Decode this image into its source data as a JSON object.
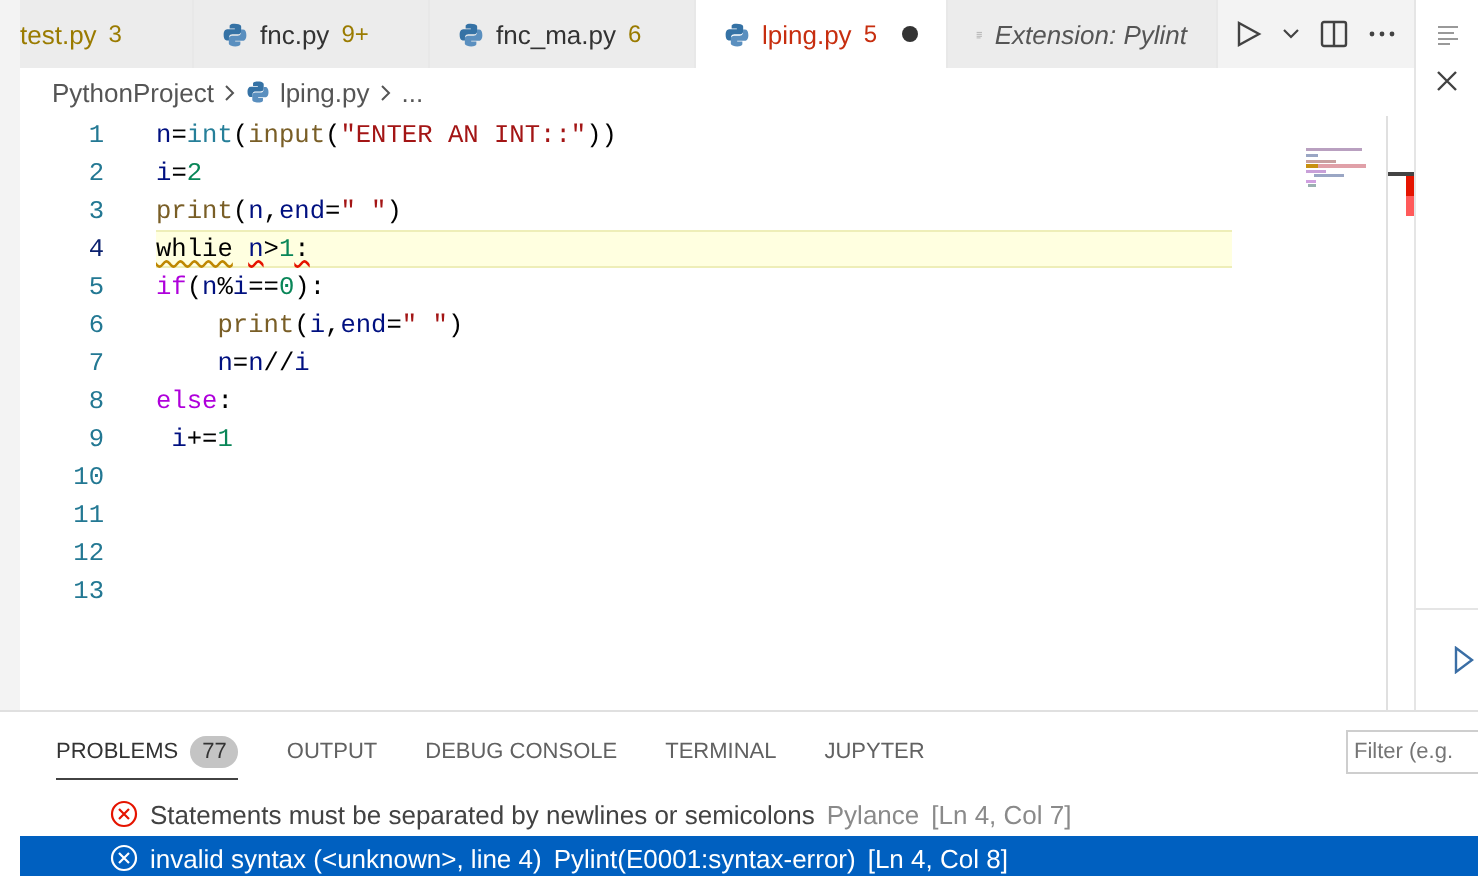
{
  "tabs": [
    {
      "label": "test.py",
      "badge": "3",
      "color": "#9a7b00",
      "highlighted": true,
      "kind": "plain",
      "dirty": false,
      "selected": false
    },
    {
      "label": "fnc.py",
      "badge": "9+",
      "color": "#9a7b00",
      "highlighted": false,
      "kind": "python",
      "dirty": false,
      "selected": false
    },
    {
      "label": "fnc_ma.py",
      "badge": "6",
      "color": "#9a7b00",
      "highlighted": false,
      "kind": "python",
      "dirty": false,
      "selected": false
    },
    {
      "label": "lping.py",
      "badge": "5",
      "color": "#c72e0f",
      "highlighted": true,
      "kind": "python",
      "dirty": true,
      "selected": true
    },
    {
      "label": "Extension: Pylint",
      "kind": "extension",
      "selected": false
    }
  ],
  "breadcrumb": {
    "folder": "PythonProject",
    "file": "lping.py",
    "more": "..."
  },
  "code": [
    {
      "number": "1",
      "current": false,
      "tokens": [
        {
          "t": "n",
          "kind": "var"
        },
        {
          "t": "=",
          "kind": "plain"
        },
        {
          "t": "int",
          "kind": "class"
        },
        {
          "t": "(",
          "kind": "plain"
        },
        {
          "t": "input",
          "kind": "func"
        },
        {
          "t": "(",
          "kind": "plain"
        },
        {
          "t": "\"ENTER AN INT::\"",
          "kind": "string"
        },
        {
          "t": "))",
          "kind": "plain"
        }
      ]
    },
    {
      "number": "2",
      "current": false,
      "tokens": [
        {
          "t": "i",
          "kind": "var"
        },
        {
          "t": "=",
          "kind": "plain"
        },
        {
          "t": "2",
          "kind": "number"
        }
      ]
    },
    {
      "number": "3",
      "current": false,
      "tokens": [
        {
          "t": "print",
          "kind": "func"
        },
        {
          "t": "(",
          "kind": "plain"
        },
        {
          "t": "n",
          "kind": "var"
        },
        {
          "t": ",",
          "kind": "plain"
        },
        {
          "t": "end",
          "kind": "var"
        },
        {
          "t": "=",
          "kind": "plain"
        },
        {
          "t": "\" \"",
          "kind": "string"
        },
        {
          "t": ")",
          "kind": "plain"
        }
      ]
    },
    {
      "number": "4",
      "current": true,
      "tokens": [
        {
          "t": "whlie",
          "kind": "plain",
          "warning": true,
          "error": false
        },
        {
          "t": " n",
          "kind": "var",
          "warning": false,
          "error": true
        },
        {
          "t": ">",
          "kind": "plain",
          "warning": false,
          "error": false
        },
        {
          "t": "1",
          "kind": "number",
          "warning": false,
          "error": false
        },
        {
          "t": ":",
          "kind": "plain",
          "warning": false,
          "error": true
        }
      ]
    },
    {
      "number": "5",
      "current": false,
      "tokens": [
        {
          "t": "if",
          "kind": "keyword"
        },
        {
          "t": "(",
          "kind": "plain"
        },
        {
          "t": "n",
          "kind": "var"
        },
        {
          "t": "%",
          "kind": "plain"
        },
        {
          "t": "i",
          "kind": "var"
        },
        {
          "t": "==",
          "kind": "plain"
        },
        {
          "t": "0",
          "kind": "number"
        },
        {
          "t": "):",
          "kind": "plain"
        }
      ]
    },
    {
      "number": "6",
      "current": false,
      "tokens": [
        {
          "t": "    print",
          "kind": "func"
        },
        {
          "t": "(",
          "kind": "plain"
        },
        {
          "t": "i",
          "kind": "var"
        },
        {
          "t": ",",
          "kind": "plain"
        },
        {
          "t": "end",
          "kind": "var"
        },
        {
          "t": "=",
          "kind": "plain"
        },
        {
          "t": "\" \"",
          "kind": "string"
        },
        {
          "t": ")",
          "kind": "plain"
        }
      ]
    },
    {
      "number": "7",
      "current": false,
      "tokens": [
        {
          "t": "    n",
          "kind": "var"
        },
        {
          "t": "=",
          "kind": "plain"
        },
        {
          "t": "n",
          "kind": "var"
        },
        {
          "t": "//",
          "kind": "plain"
        },
        {
          "t": "i",
          "kind": "var"
        }
      ]
    },
    {
      "number": "8",
      "current": false,
      "tokens": [
        {
          "t": "else",
          "kind": "keyword"
        },
        {
          "t": ":",
          "kind": "plain"
        }
      ]
    },
    {
      "number": "9",
      "current": false,
      "tokens": [
        {
          "t": " i",
          "kind": "var"
        },
        {
          "t": "+=",
          "kind": "plain"
        },
        {
          "t": "1",
          "kind": "number"
        }
      ]
    },
    {
      "number": "10",
      "current": false
    },
    {
      "number": "11",
      "current": false
    },
    {
      "number": "12",
      "current": false
    },
    {
      "number": "13",
      "current": false
    }
  ],
  "panel_tabs": [
    {
      "label": "PROBLEMS",
      "badge": "77",
      "selected": true
    },
    {
      "label": "OUTPUT",
      "selected": false
    },
    {
      "label": "DEBUG CONSOLE",
      "selected": false
    },
    {
      "label": "TERMINAL",
      "selected": false
    },
    {
      "label": "JUPYTER",
      "selected": false
    }
  ],
  "filter": {
    "placeholder": "Filter (e.g."
  },
  "problems": [
    {
      "message": "Statements must be separated by newlines or semicolons",
      "source": "Pylance",
      "location": "[Ln 4, Col 7]",
      "selected": false
    },
    {
      "message": "invalid syntax (<unknown>, line 4)",
      "source": "Pylint(E0001:syntax-error)",
      "location": "[Ln 4, Col 8]",
      "selected": true
    }
  ]
}
